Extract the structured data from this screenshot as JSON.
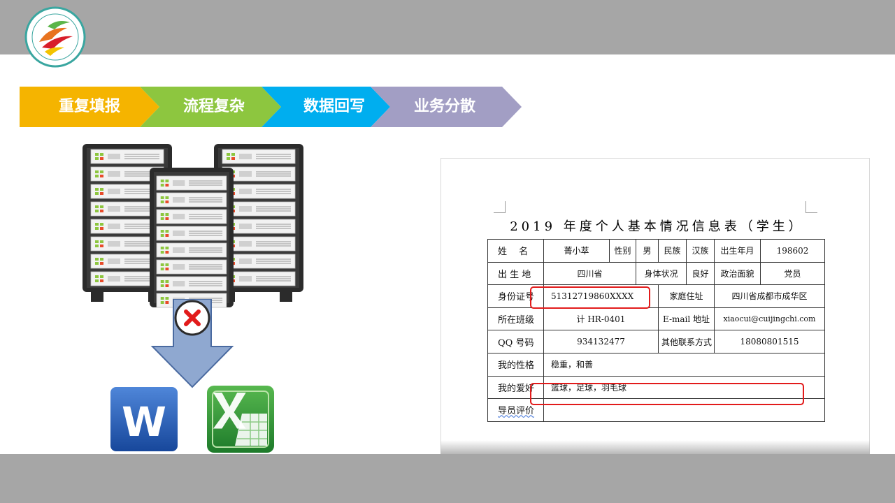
{
  "colors": {
    "bars": "#a6a6a6",
    "step1": "#f5b400",
    "step2": "#8dc63f",
    "step3": "#00aeef",
    "step4": "#a29ec4",
    "highlight": "#e21b1b"
  },
  "logo": {
    "icon": "college-emblem-icon"
  },
  "banner": {
    "steps": [
      "重复填报",
      "流程复杂",
      "数据回写",
      "业务分散"
    ]
  },
  "illustration": {
    "icons": [
      "server-rack-icon",
      "blocked-x-icon",
      "down-arrow-icon",
      "word-icon",
      "excel-icon"
    ],
    "word_letter": "W"
  },
  "form": {
    "title": "2019 年度个人基本情况信息表（学生）",
    "rows": [
      [
        "姓　 名",
        "菁小萃",
        "性别",
        "男",
        "民族",
        "汉族",
        "出生年月",
        "198602"
      ],
      [
        "出 生 地",
        "四川省",
        "身体状况",
        "良好",
        "政治面貌",
        "党员"
      ],
      [
        "身份证号",
        "51312719860XXXX",
        "家庭住址",
        "四川省成都市成华区"
      ],
      [
        "所在班级",
        "计 HR-0401",
        "E-mail 地址",
        "xiaocui@cuijingchi.com"
      ],
      [
        "QQ 号码",
        "934132477",
        "其他联系方式",
        "18080801515"
      ],
      [
        "我的性格",
        "稳重，和善"
      ],
      [
        "我的爱好",
        "篮球，足球，羽毛球"
      ],
      [
        "导员评价",
        ""
      ]
    ]
  }
}
